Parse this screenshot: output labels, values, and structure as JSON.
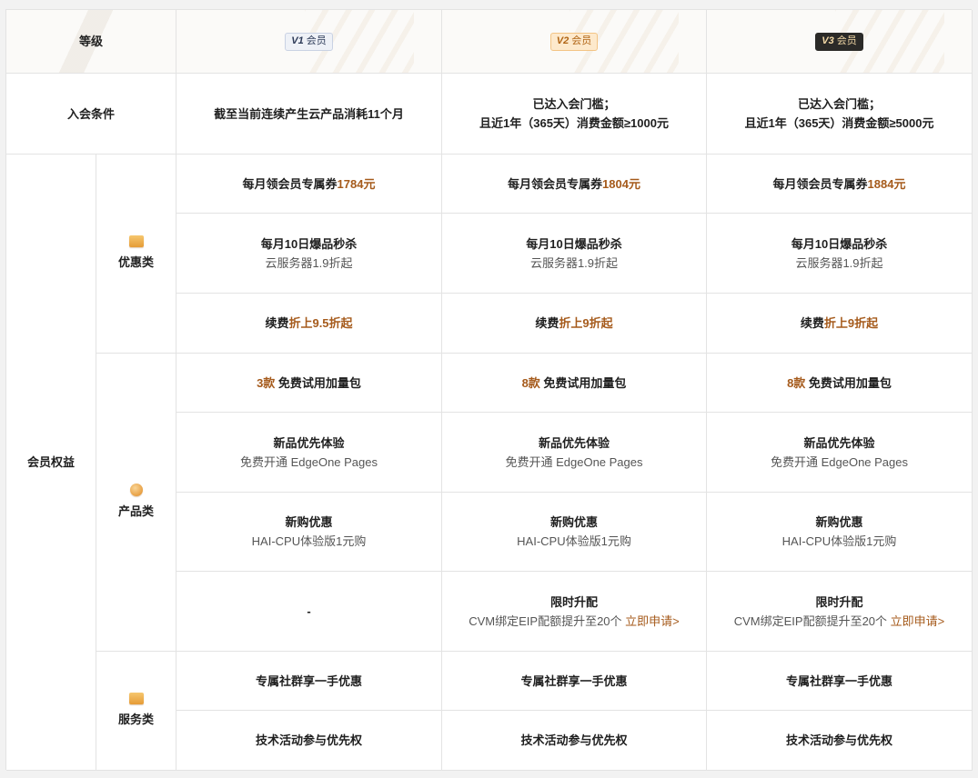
{
  "header": {
    "level_label": "等级",
    "tiers": [
      {
        "badge": "V1",
        "text": "会员"
      },
      {
        "badge": "V2",
        "text": "会员"
      },
      {
        "badge": "V3",
        "text": "会员"
      }
    ]
  },
  "conditions": {
    "label": "入会条件",
    "tiers": [
      {
        "line1": "截至当前连续产生云产品消耗11个月",
        "line2": ""
      },
      {
        "line1": "已达入会门槛；",
        "line2": "且近1年（365天）消费金额≥1000元"
      },
      {
        "line1": "已达入会门槛；",
        "line2": "且近1年（365天）消费金额≥5000元"
      }
    ]
  },
  "benefits_label": "会员权益",
  "categories": {
    "discount": "优惠类",
    "product": "产品类",
    "service": "服务类"
  },
  "rows": {
    "coupon": {
      "prefix": "每月领会员专属券",
      "amounts": [
        "1784元",
        "1804元",
        "1884元"
      ]
    },
    "flash_sale": {
      "title": "每月10日爆品秒杀",
      "sub": "云服务器1.9折起"
    },
    "renewal": {
      "prefix": "续费",
      "discounts": [
        "折上9.5折起",
        "折上9折起",
        "折上9折起"
      ]
    },
    "trial_pack": {
      "counts": [
        "3款",
        "8款",
        "8款"
      ],
      "suffix": "免费试用加量包"
    },
    "new_product": {
      "title": "新品优先体验",
      "sub": "免费开通 EdgeOne Pages"
    },
    "new_purchase": {
      "title": "新购优惠",
      "sub": "HAI-CPU体验版1元购"
    },
    "upgrade": {
      "v1_value": "-",
      "title": "限时升配",
      "sub": "CVM绑定EIP配额提升至20个",
      "link": "立即申请>"
    },
    "community": {
      "text": "专属社群享一手优惠"
    },
    "tech_events": {
      "text": "技术活动参与优先权"
    }
  }
}
